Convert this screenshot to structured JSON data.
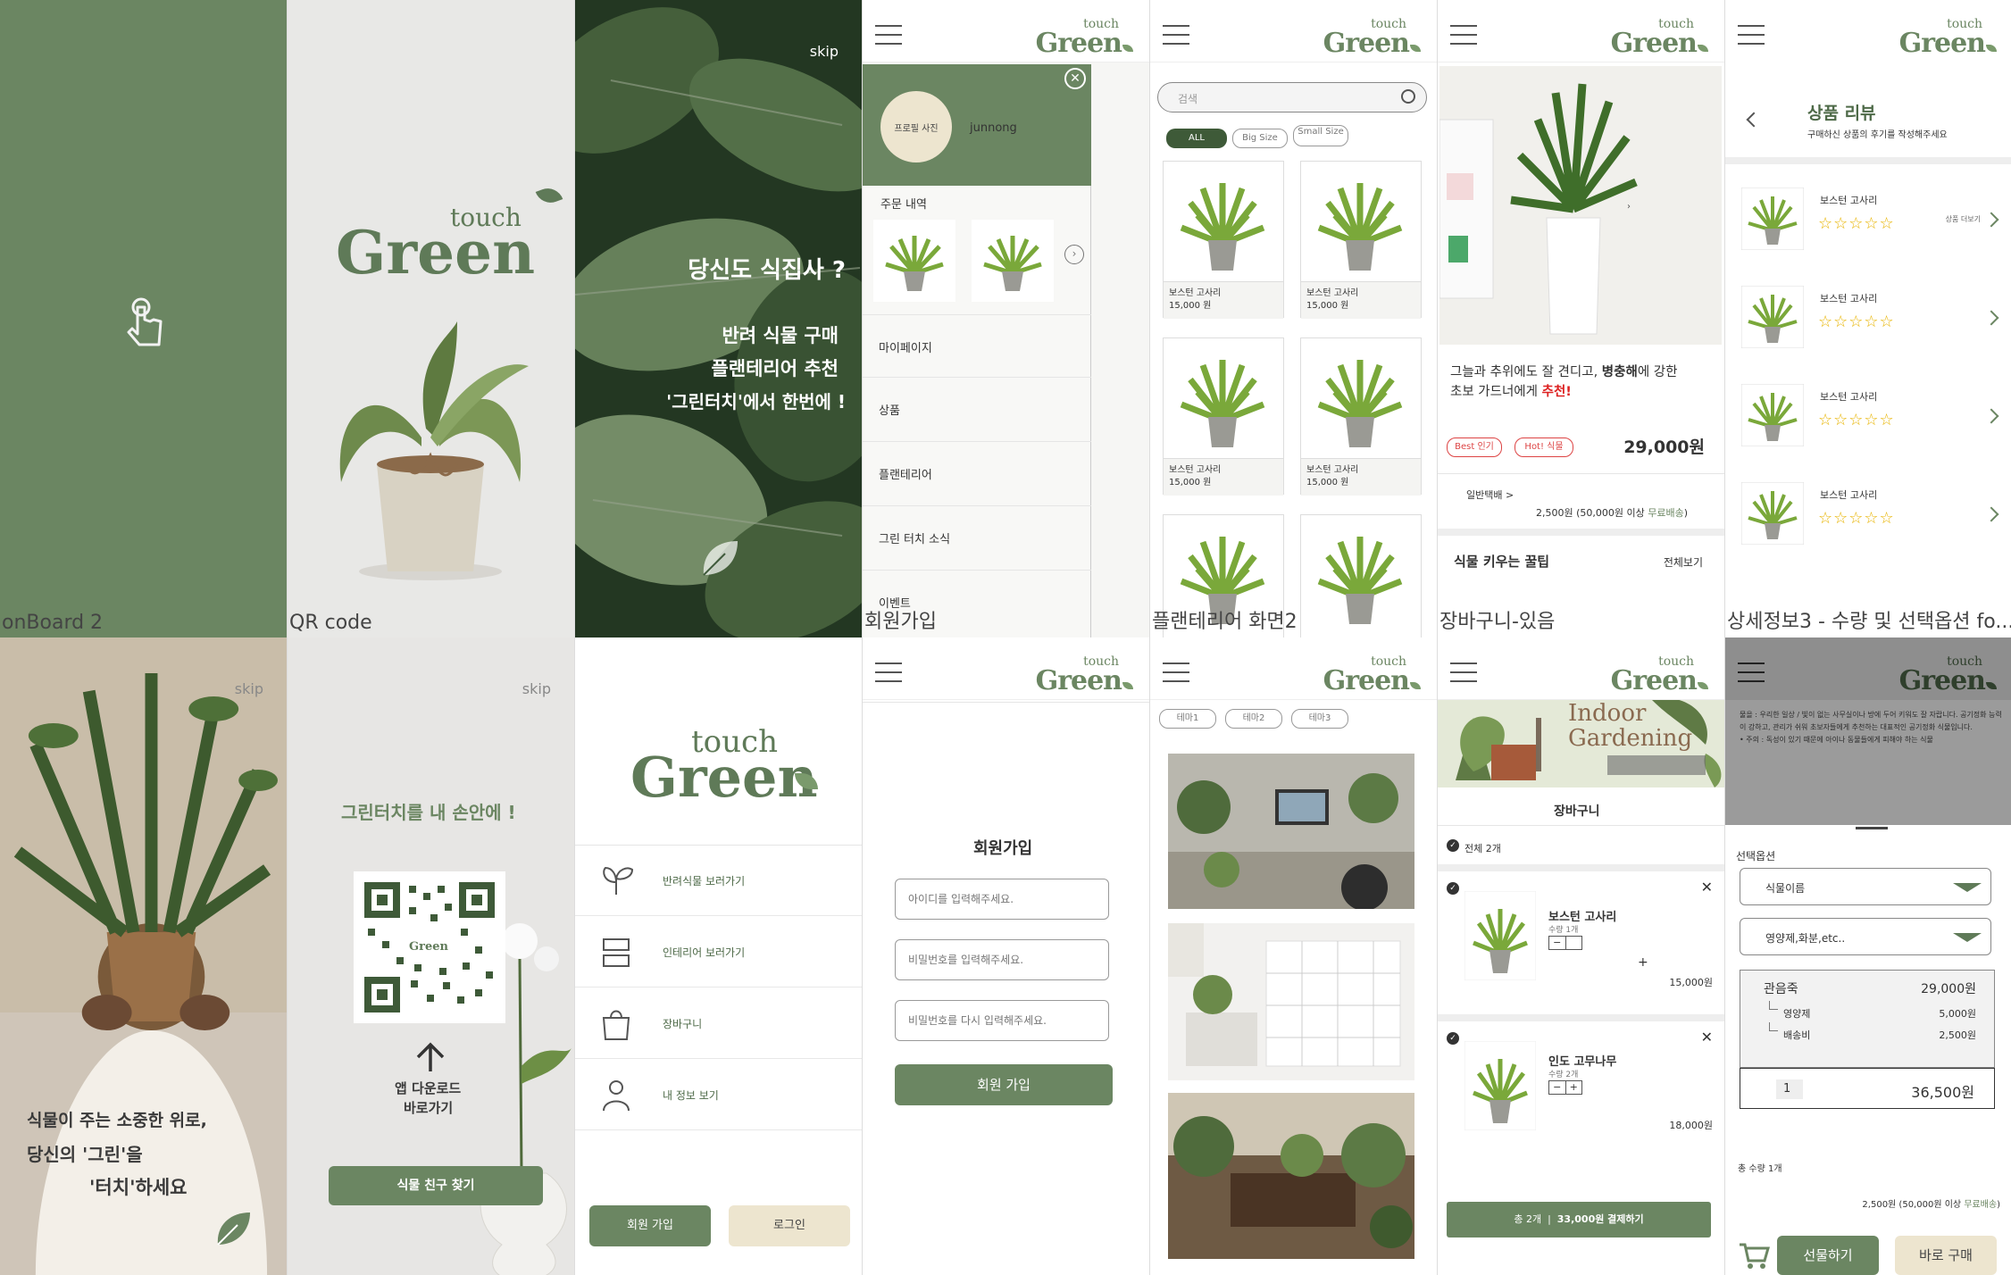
{
  "frames": {
    "onboard2": {
      "label": "onBoard 2",
      "bg": "#6b8662",
      "icon": "touch-hand-icon"
    },
    "qrcode": {
      "label": "QR code",
      "logo_small": "touch",
      "logo_big": "Green"
    },
    "intro": {
      "skip": "skip",
      "headline": "당신도 식집사 ?",
      "line1": "반려 식물 구매",
      "line2": "플랜테리어 추천",
      "line3": "'그린터치'에서 한번에 !"
    },
    "menu": {
      "label": "회원가입",
      "profile_placeholder": "프로필 사진",
      "username": "junnong",
      "orders_title": "주문 내역",
      "items": [
        "마이페이지",
        "상품",
        "플랜테리어",
        "그린 터치 소식",
        "이벤트"
      ]
    },
    "plantlist": {
      "label": "플랜테리어 화면2",
      "search_placeholder": "검색",
      "filters": [
        "ALL",
        "Big Size",
        "Small Size"
      ],
      "products": [
        {
          "name": "보스턴 고사리",
          "price": "15,000 원"
        },
        {
          "name": "보스턴 고사리",
          "price": "15,000 원"
        },
        {
          "name": "보스턴 고사리",
          "price": "15,000 원"
        },
        {
          "name": "보스턴 고사리",
          "price": "15,000 원"
        }
      ]
    },
    "detail": {
      "label": "장바구니-있음",
      "desc1_a": "그늘과 추위에도 잘 견디고, ",
      "desc1_b": "병충해",
      "desc1_c": "에 강한",
      "desc2_a": "초보 가드너에게 ",
      "desc2_b": "추천!",
      "badge1": "Best 인기",
      "badge2": "Hot! 식물",
      "price": "29,000원",
      "shipping_label": "일반택배 >",
      "shipping_fee": "2,500원 (50,000원 이상 ",
      "shipping_free": "무료배송",
      "shipping_end": ")",
      "tips_title": "식물 키우는 꿀팁",
      "tips_more": "전체보기"
    },
    "review": {
      "label": "상세정보3 - 수량 및 선택옵션 fo...",
      "title": "상품 리뷰",
      "subtitle": "구매하신 상품의 후기를 작성해주세요",
      "more": "상품 더보기",
      "items": [
        {
          "name": "보스턴 고사리",
          "stars": "☆☆☆☆☆"
        },
        {
          "name": "보스턴 고사리",
          "stars": "☆☆☆☆☆"
        },
        {
          "name": "보스턴 고사리",
          "stars": "☆☆☆☆☆"
        },
        {
          "name": "보스턴 고사리",
          "stars": "☆☆☆☆☆"
        }
      ]
    },
    "quote": {
      "skip": "skip",
      "line1": "식물이 주는 소중한 위로,",
      "line2": "당신의 '그린'을",
      "line3": "'터치'하세요"
    },
    "download": {
      "skip": "skip",
      "headline": "그린터치를 내 손안에 !",
      "arrow_text1": "앱 다운로드",
      "arrow_text2": "바로가기",
      "button": "식물 친구 찾기"
    },
    "home": {
      "logo_small": "touch",
      "logo_big": "Green",
      "items": [
        "반려식물 보러가기",
        "인테리어 보러가기",
        "장바구니",
        "내 정보 보기"
      ],
      "join": "회원 가입",
      "login": "로그인"
    },
    "signup": {
      "title": "회원가입",
      "id_placeholder": "아이디를 입력해주세요.",
      "pw_placeholder": "비밀번호를 입력해주세요.",
      "pw2_placeholder": "비밀번호를 다시 입력해주세요.",
      "button": "회원 가입"
    },
    "themes": {
      "tabs": [
        "테마1",
        "테마2",
        "테마3"
      ]
    },
    "cart": {
      "banner1": "Indoor",
      "banner2": "Gardening",
      "title": "장바구니",
      "all": "전체 2개",
      "item1": {
        "name": "보스턴 고사리",
        "qty": "수량 1개",
        "price": "15,000원"
      },
      "item2": {
        "name": "인도 고무나무",
        "qty": "수량 2개",
        "price": "18,000원"
      },
      "checkout_a": "총 2개",
      "checkout_b": "33,000원 결제하기"
    },
    "option": {
      "sheet_text": "물을 : 우리한 일상 / 빛이 없는 사무실이나 방에 두어 키워도 잘 자랍니다. 공기정화 능력이 강하고, 관리가 쉬워 초보자들에게 추천하는 대표적인 공기정화 식물입니다.",
      "sheet_text2": "• 주의 : 독성이 있기 때문에 아이나 동물들에게 피해야 하는 식물",
      "section": "선택옵션",
      "select1": "식물이름",
      "select2": "영양제,화분,etc..",
      "row_main": "관음죽",
      "row_main_price": "29,000원",
      "row_sub1": "영양제",
      "row_sub1_price": "5,000원",
      "row_sub2": "배송비",
      "row_sub2_price": "2,500원",
      "qty": "1",
      "total": "36,500원",
      "total_qty": "총 수량 1개",
      "ship": "2,500원 (50,000원 이상 ",
      "ship_free": "무료배송",
      "ship_end": ")",
      "gift": "선물하기",
      "buy": "바로 구매"
    }
  }
}
